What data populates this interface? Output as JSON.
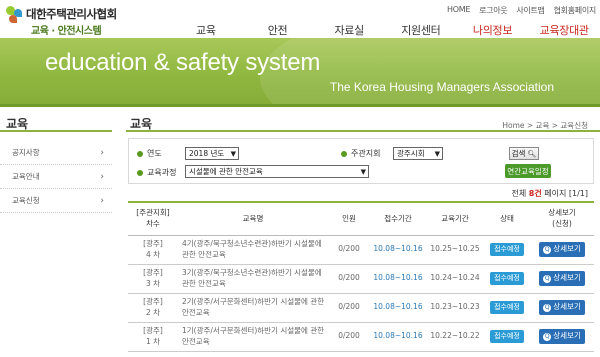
{
  "header": {
    "logo_title": "대한주택관리사협회",
    "logo_sub": "교육 · 안전시스템",
    "util": [
      "HOME",
      "로그아웃",
      "사이트맵",
      "협회홈페이지"
    ],
    "nav": [
      "교육",
      "안전",
      "자료실",
      "지원센터",
      "나의정보",
      "교육장대관"
    ]
  },
  "banner": {
    "title": "education & safety system",
    "subtitle": "The Korea Housing Managers Association"
  },
  "sidebar": {
    "title": "교육",
    "items": [
      "공지사항",
      "교육안내",
      "교육신청"
    ]
  },
  "content": {
    "title": "교육",
    "breadcrumb": "Home > 교육 > 교육신청",
    "filter": {
      "year_label": "연도",
      "year_value": "2018 년도",
      "host_label": "주관지회",
      "host_value": "광주시회",
      "course_label": "교육과정",
      "course_value": "시설물에 관한 안전교육",
      "search_label": "검색",
      "yearly_label": "연간교육일정"
    },
    "summary": {
      "prefix": "전체",
      "count": "8건",
      "page_label": "페이지",
      "page": "[1/1]"
    },
    "table": {
      "headers": {
        "col1_a": "[주관지회]",
        "col1_b": "차수",
        "col2": "교육명",
        "col3": "인원",
        "col4": "접수기간",
        "col5": "교육기간",
        "col6": "상태",
        "col7_a": "상세보기",
        "col7_b": "(신청)"
      },
      "rows": [
        {
          "host": "[광주]",
          "round": "4 차",
          "name": "4기(광주/북구청소년수련관)하반기 시설물에 관한 안전교육",
          "capacity": "0/200",
          "reg_period": "10.08~10.16",
          "edu_period": "10.25~10.25",
          "status": "접수예정",
          "detail": "상세보기"
        },
        {
          "host": "[광주]",
          "round": "3 차",
          "name": "3기(광주/북구청소년수련관)하반기 시설물에 관한 안전교육",
          "capacity": "0/200",
          "reg_period": "10.08~10.16",
          "edu_period": "10.24~10.24",
          "status": "접수예정",
          "detail": "상세보기"
        },
        {
          "host": "[광주]",
          "round": "2 차",
          "name": "2기(광주/서구문화센터)하반기 시설물에 관한 안전교육",
          "capacity": "0/200",
          "reg_period": "10.08~10.16",
          "edu_period": "10.23~10.23",
          "status": "접수예정",
          "detail": "상세보기"
        },
        {
          "host": "[광주]",
          "round": "1 차",
          "name": "1기(광주/서구문화센터)하반기 시설물에 관한 안전교육",
          "capacity": "0/200",
          "reg_period": "10.08~10.16",
          "edu_period": "10.22~10.22",
          "status": "접수예정",
          "detail": "상세보기"
        }
      ]
    }
  },
  "colors": {
    "accent_green": "#8cb43c",
    "nav_red": "#c8281e",
    "button_blue": "#2a6fb6"
  },
  "icons": {
    "detail": "search-icon",
    "chevron": "chevron-right-icon",
    "logo": "association-logo-icon"
  }
}
